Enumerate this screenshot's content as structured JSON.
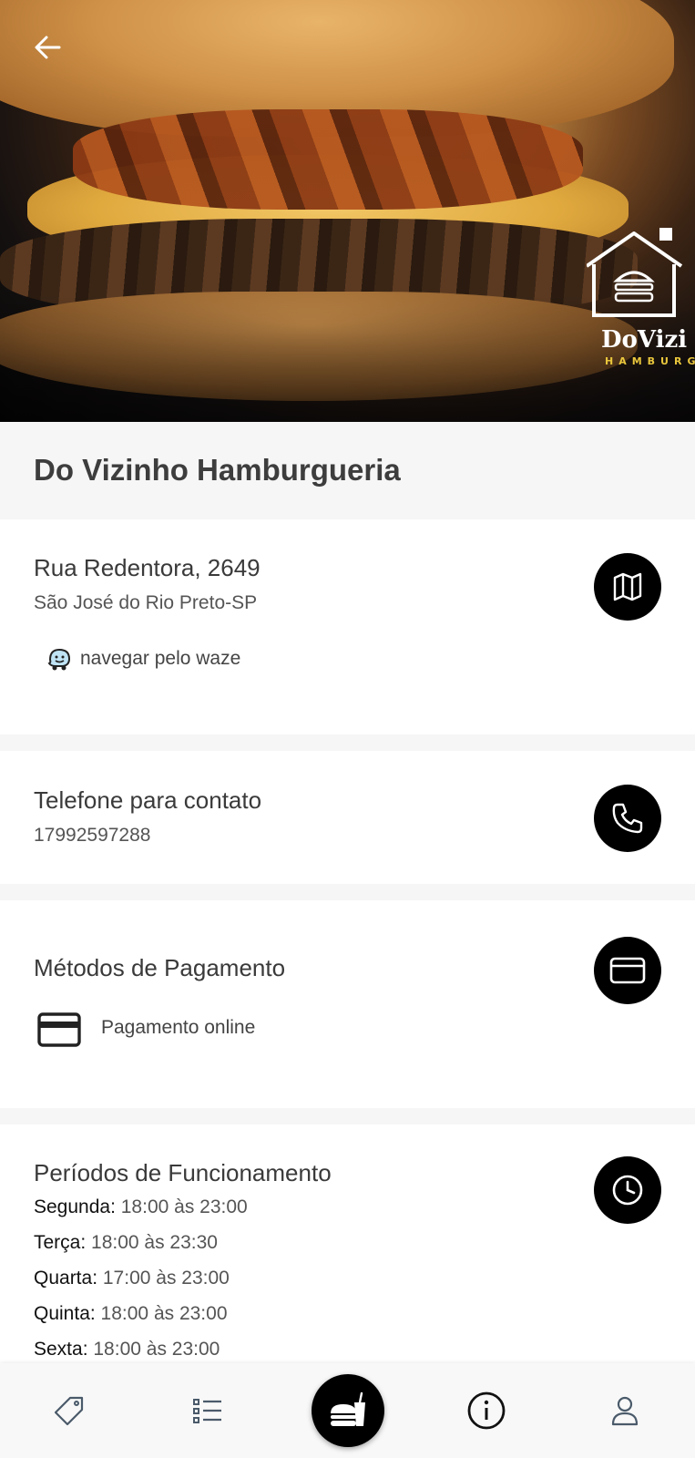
{
  "hero": {
    "brand_name": "DoVizi",
    "brand_sub": "HAMBURG",
    "back_icon": "arrow-left-icon"
  },
  "restaurant": {
    "name": "Do Vizinho Hamburgueria"
  },
  "address": {
    "street": "Rua Redentora, 2649",
    "city": "São José do Rio Preto-SP",
    "waze_label": "navegar pelo waze",
    "map_icon": "map-icon"
  },
  "contact": {
    "heading": "Telefone para contato",
    "phone": "17992597288",
    "phone_icon": "phone-icon"
  },
  "payment": {
    "heading": "Métodos de Pagamento",
    "method": "Pagamento online",
    "icon": "credit-card-icon"
  },
  "hours": {
    "heading": "Períodos de Funcionamento",
    "days": [
      {
        "day": "Segunda:",
        "time": " 18:00 às 23:00"
      },
      {
        "day": "Terça:",
        "time": " 18:00 às 23:30"
      },
      {
        "day": "Quarta:",
        "time": " 17:00 às 23:00"
      },
      {
        "day": "Quinta:",
        "time": " 18:00 às 23:00"
      },
      {
        "day": "Sexta:",
        "time": " 18:00 às 23:00"
      }
    ],
    "icon": "clock-icon"
  },
  "nav": {
    "items": [
      "tag-icon",
      "list-icon",
      "food-icon",
      "info-icon",
      "user-icon"
    ],
    "active": "info-icon"
  }
}
